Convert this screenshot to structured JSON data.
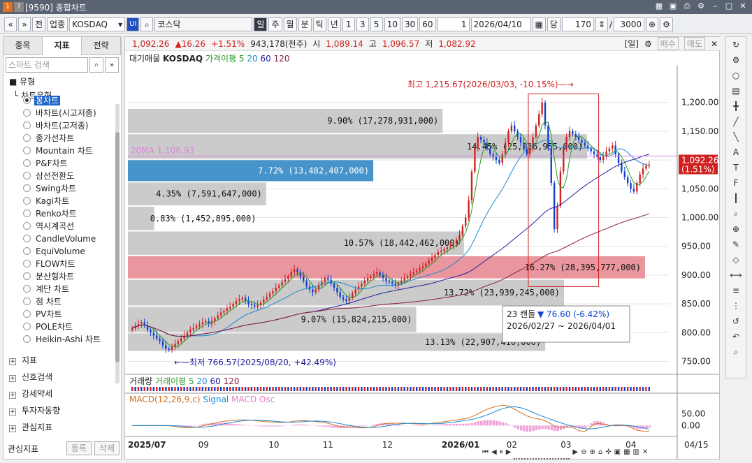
{
  "window": {
    "title": "[9590] 종합차트",
    "controls": [
      "layout-icon",
      "save-icon",
      "print-icon",
      "settings-icon",
      "minimize-icon",
      "maximize-icon",
      "close-icon"
    ]
  },
  "toolbar": {
    "nav_prev": "«",
    "nav_down": "»",
    "btn_prev": "전",
    "btn_sector": "업종",
    "symbol": "KOSDAQ",
    "ui_badge": "UI",
    "market": "코스닥",
    "periods": [
      "일",
      "주",
      "월",
      "분",
      "틱",
      "년"
    ],
    "active_period": "일",
    "intervals": [
      "1",
      "3",
      "5",
      "10",
      "30",
      "60"
    ],
    "spin_value": "1",
    "date": "2026/04/10",
    "date_label": "당",
    "count": "170",
    "separator": "/",
    "total": "3000"
  },
  "sidebar": {
    "tabs": [
      "종목",
      "지표",
      "전략"
    ],
    "active_tab": "지표",
    "search_placeholder": "스마트 검색",
    "folder": "유형",
    "subfolder": "차트유형",
    "items": [
      {
        "label": "봉차트",
        "selected": true
      },
      {
        "label": "바차트(시고저종)"
      },
      {
        "label": "바차트(고저종)"
      },
      {
        "label": "종가선차트"
      },
      {
        "label": "Mountain 차트"
      },
      {
        "label": "P&F차트"
      },
      {
        "label": "삼선전환도"
      },
      {
        "label": "Swing차트"
      },
      {
        "label": "Kagi차트"
      },
      {
        "label": "Renko차트"
      },
      {
        "label": "역시계곡선"
      },
      {
        "label": "CandleVolume"
      },
      {
        "label": "EquiVolume"
      },
      {
        "label": "FLOW차트"
      },
      {
        "label": "분산형차트"
      },
      {
        "label": "계단 차트"
      },
      {
        "label": "점 차트"
      },
      {
        "label": "PV차트"
      },
      {
        "label": "POLE차트"
      },
      {
        "label": "Heikin-Ashi 차트"
      }
    ],
    "groups": [
      "지표",
      "신호검색",
      "강세약세",
      "투자자동향",
      "관심지표"
    ],
    "footer_label": "관심지표",
    "footer_add": "등록",
    "footer_del": "삭제"
  },
  "pricebar": {
    "price": "1,092.26",
    "change": "▲16.26",
    "change_pct": "+1.51%",
    "volume": "943,178(천주)",
    "open_label": "시",
    "open": "1,089.14",
    "high_label": "고",
    "high": "1,096.57",
    "low_label": "저",
    "low": "1,082.92",
    "period_tag": "[일]",
    "buy_btn": "매수",
    "sell_btn": "매도"
  },
  "legend": {
    "main": "대기매물",
    "symbol": "KOSDAQ",
    "ma_label": "가격이평",
    "ma_values": [
      "5",
      "20",
      "60",
      "120"
    ],
    "volume": "거래량",
    "vol_ma_label": "거래이평",
    "vol_ma_values": [
      "5",
      "20",
      "60",
      "120"
    ],
    "macd": "MACD(12,26,9,c)",
    "signal": "Signal",
    "osc": "MACD Osc"
  },
  "chart_data": {
    "type": "candlestick",
    "ylim": [
      730,
      1230
    ],
    "y_ticks": [
      750,
      800,
      850,
      900,
      950,
      1000,
      1050,
      1100,
      1150,
      1200
    ],
    "y_tick_labels": [
      "750.00",
      "800.00",
      "850.00",
      "900.00",
      "950.00",
      "1,000.00",
      "1,050.00",
      "1,100.00",
      "1,150.00",
      "1,200.00"
    ],
    "x_labels": [
      "2025/07",
      "09",
      "10",
      "11",
      "12",
      "2026/01",
      "02",
      "03",
      "04"
    ],
    "last_date": "04/15",
    "current_price_label": "1,092.26",
    "current_change_label": "(1.51%)",
    "ma20_label": "20MA 1,106.93",
    "ma20": 1106.93,
    "annotations": {
      "high": "최고 1,215.67(2026/03/03, -10.15%)",
      "low": "최저 766.57(2025/08/20, +42.49%)",
      "box_candles": "23 캔들",
      "box_change": "76.60 (-6.42%)",
      "box_dates": "2026/02/27 ~ 2026/04/01"
    },
    "volume_profile": [
      {
        "low": 767,
        "high": 800,
        "pct": "13.13%",
        "vol": "22,907,410,000"
      },
      {
        "low": 800,
        "high": 846,
        "pct": "9.07%",
        "vol": "15,824,215,000"
      },
      {
        "low": 846,
        "high": 893,
        "pct": "13.72%",
        "vol": "23,939,245,000"
      },
      {
        "low": 893,
        "high": 934,
        "pct": "16.27%",
        "vol": "28,395,777,000",
        "poc": true
      },
      {
        "low": 934,
        "high": 977,
        "pct": "10.57%",
        "vol": "18,442,462,000"
      },
      {
        "low": 977,
        "high": 1020,
        "pct": "0.83%",
        "vol": "1,452,895,000"
      },
      {
        "low": 1020,
        "high": 1062,
        "pct": "4.35%",
        "vol": "7,591,647,000"
      },
      {
        "low": 1062,
        "high": 1101,
        "pct": "7.72%",
        "vol": "13,482,407,000",
        "current": true
      },
      {
        "low": 1101,
        "high": 1146,
        "pct": "14.45%",
        "vol": "25,216,955,000"
      },
      {
        "low": 1146,
        "high": 1190,
        "pct": "9.90%",
        "vol": "17,278,931,000"
      }
    ],
    "closes": [
      808,
      812,
      815,
      818,
      812,
      805,
      800,
      795,
      790,
      785,
      778,
      772,
      770,
      775,
      780,
      785,
      790,
      795,
      800,
      805,
      808,
      812,
      815,
      818,
      820,
      815,
      820,
      825,
      830,
      835,
      838,
      842,
      845,
      850,
      855,
      858,
      860,
      855,
      850,
      848,
      845,
      848,
      852,
      858,
      862,
      868,
      872,
      878,
      882,
      888,
      893,
      898,
      905,
      910,
      905,
      898,
      890,
      880,
      875,
      870,
      875,
      882,
      888,
      895,
      892,
      885,
      878,
      870,
      862,
      858,
      855,
      860,
      868,
      875,
      880,
      885,
      890,
      895,
      898,
      902,
      905,
      900,
      895,
      890,
      888,
      885,
      882,
      886,
      890,
      895,
      898,
      902,
      905,
      908,
      912,
      915,
      920,
      925,
      930,
      935,
      940,
      942,
      945,
      948,
      950,
      955,
      960,
      970,
      985,
      1000,
      1030,
      1080,
      1120,
      1140,
      1135,
      1130,
      1120,
      1110,
      1105,
      1100,
      1095,
      1110,
      1130,
      1150,
      1160,
      1150,
      1140,
      1130,
      1120,
      1110,
      1120,
      1140,
      1160,
      1180,
      1200,
      1160,
      1120,
      1060,
      980,
      1020,
      1080,
      1120,
      1140,
      1150,
      1145,
      1140,
      1135,
      1130,
      1125,
      1120,
      1115,
      1110,
      1105,
      1100,
      1108,
      1115,
      1120,
      1125,
      1110,
      1095,
      1080,
      1070,
      1060,
      1050,
      1045,
      1060,
      1075,
      1085,
      1090,
      1092
    ],
    "ma20_line": "smooth",
    "macd_ylim": [
      -40,
      80
    ],
    "macd_ticks": [
      0,
      50
    ],
    "macd_tick_labels": [
      "0.00",
      "50.00"
    ]
  },
  "right_toolbar": [
    "refresh-icon",
    "gear-icon",
    "circle-icon",
    "chart-icon",
    "crosshair-icon",
    "line-icon",
    "diag-icon",
    "auto-icon",
    "text-icon",
    "fib-icon",
    "candle-icon",
    "zoom-icon",
    "zoomin-icon",
    "pen-icon",
    "shape-icon",
    "measure-icon",
    "bars-icon",
    "bars2-icon",
    "rotate-icon",
    "undo-icon",
    "search-icon"
  ]
}
